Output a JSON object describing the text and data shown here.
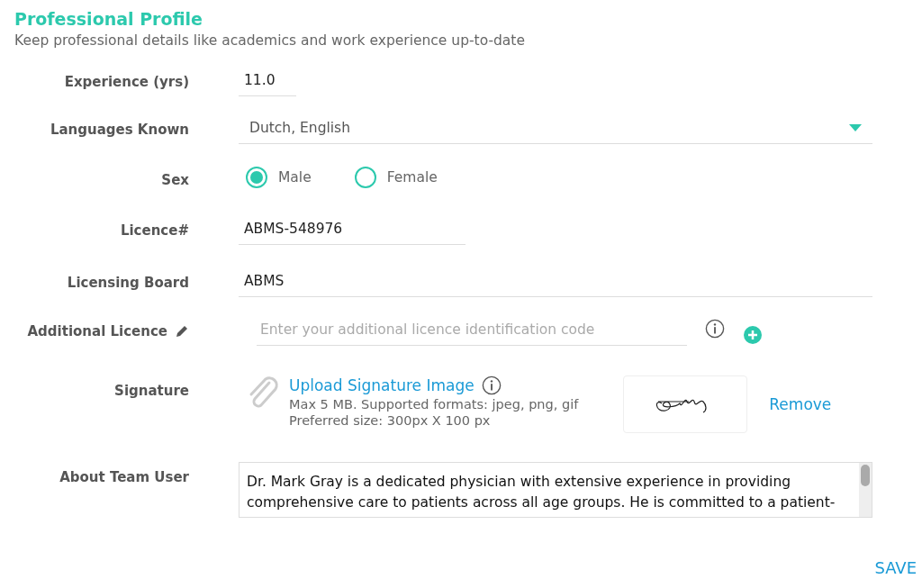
{
  "header": {
    "title": "Professional Profile",
    "subtitle": "Keep professional details like academics and work experience up-to-date"
  },
  "fields": [
    {
      "kind": "short",
      "label": "Experience (yrs)",
      "value": "11.0"
    },
    {
      "kind": "select",
      "label": "Languages Known",
      "value": "Dutch, English"
    },
    {
      "kind": "radio",
      "label": "Sex",
      "options": [
        {
          "label": "Male",
          "selected": true
        },
        {
          "label": "Female",
          "selected": false
        }
      ]
    },
    {
      "kind": "medium",
      "label": "Licence#",
      "value": "ABMS-548976"
    },
    {
      "kind": "wide",
      "label": "Licensing Board",
      "value": "ABMS"
    },
    {
      "kind": "add",
      "label": "Additional Licence",
      "placeholder": "Enter your additional licence identification code"
    },
    {
      "kind": "signature",
      "label": "Signature",
      "link": "Upload Signature Image",
      "hint_1": "Max 5 MB. Supported formats: jpeg, png, gif",
      "hint_2": "Preferred size: 300px X 100 px",
      "remove": "Remove"
    },
    {
      "kind": "textarea",
      "label": "About Team User",
      "value": "Dr. Mark Gray is a dedicated physician with extensive experience in providing comprehensive care to patients across all age groups. He is committed to a patient-"
    }
  ],
  "save": "SAVE"
}
